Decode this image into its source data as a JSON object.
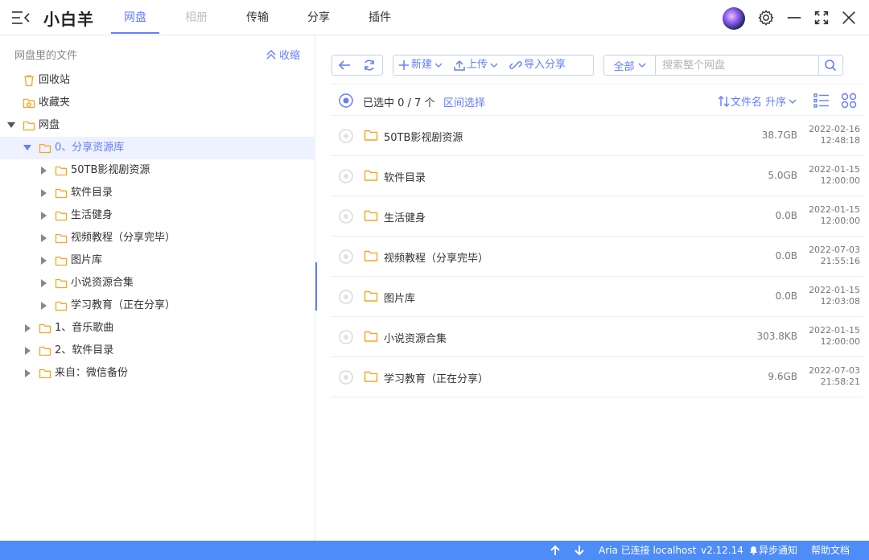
{
  "app": {
    "title": "小白羊",
    "tabs": [
      {
        "label": "网盘",
        "state": "active"
      },
      {
        "label": "相册",
        "state": "disabled"
      },
      {
        "label": "传输",
        "state": "normal"
      },
      {
        "label": "分享",
        "state": "normal"
      },
      {
        "label": "插件",
        "state": "normal"
      }
    ]
  },
  "colors": {
    "accent": "#637dff",
    "folder": "#f5a623",
    "statusbar": "#4e8cf7"
  },
  "sidebar": {
    "heading": "网盘里的文件",
    "collapse_label": "收缩",
    "tree": [
      {
        "label": "回收站",
        "icon": "trash-icon",
        "depth": 0,
        "arrow": "none"
      },
      {
        "label": "收藏夹",
        "icon": "star-folder-icon",
        "depth": 0,
        "arrow": "none"
      },
      {
        "label": "网盘",
        "icon": "folder-icon",
        "depth": 0,
        "arrow": "expanded"
      },
      {
        "label": "0、分享资源库",
        "icon": "folder-icon",
        "depth": 1,
        "arrow": "expanded",
        "selected": true
      },
      {
        "label": "50TB影视剧资源",
        "icon": "folder-icon",
        "depth": 2,
        "arrow": "collapsed"
      },
      {
        "label": "软件目录",
        "icon": "folder-icon",
        "depth": 2,
        "arrow": "collapsed"
      },
      {
        "label": "生活健身",
        "icon": "folder-icon",
        "depth": 2,
        "arrow": "collapsed"
      },
      {
        "label": "视频教程（分享完毕）",
        "icon": "folder-icon",
        "depth": 2,
        "arrow": "collapsed"
      },
      {
        "label": "图片库",
        "icon": "folder-icon",
        "depth": 2,
        "arrow": "collapsed"
      },
      {
        "label": "小说资源合集",
        "icon": "folder-icon",
        "depth": 2,
        "arrow": "collapsed"
      },
      {
        "label": "学习教育（正在分享）",
        "icon": "folder-icon",
        "depth": 2,
        "arrow": "collapsed"
      },
      {
        "label": "1、音乐歌曲",
        "icon": "folder-icon",
        "depth": 1,
        "arrow": "collapsed"
      },
      {
        "label": "2、软件目录",
        "icon": "folder-icon",
        "depth": 1,
        "arrow": "collapsed"
      },
      {
        "label": "来自：微信备份",
        "icon": "folder-icon",
        "depth": 1,
        "arrow": "collapsed"
      }
    ]
  },
  "toolbar": {
    "new_label": "新建",
    "upload_label": "上传",
    "import_share_label": "导入分享",
    "search_scope": "全部",
    "search_placeholder": "搜索整个网盘"
  },
  "selection": {
    "status": "已选中 0 / 7 个",
    "range_label": "区间选择",
    "sort_label": "文件名 升序"
  },
  "files": [
    {
      "name": "50TB影视剧资源",
      "size": "38.7GB",
      "date": "2022-02-16",
      "time": "12:48:18"
    },
    {
      "name": "软件目录",
      "size": "5.0GB",
      "date": "2022-01-15",
      "time": "12:00:00"
    },
    {
      "name": "生活健身",
      "size": "0.0B",
      "date": "2022-01-15",
      "time": "12:00:00"
    },
    {
      "name": "视频教程（分享完毕）",
      "size": "0.0B",
      "date": "2022-07-03",
      "time": "21:55:16"
    },
    {
      "name": "图片库",
      "size": "0.0B",
      "date": "2022-01-15",
      "time": "12:03:08"
    },
    {
      "name": "小说资源合集",
      "size": "303.8KB",
      "date": "2022-01-15",
      "time": "12:00:00"
    },
    {
      "name": "学习教育（正在分享）",
      "size": "9.6GB",
      "date": "2022-07-03",
      "time": "21:58:21"
    }
  ],
  "statusbar": {
    "aria_status": "Aria 已连接 localhost",
    "version": "v2.12.14",
    "async_notice": "异步通知",
    "help_label": "帮助文档"
  }
}
